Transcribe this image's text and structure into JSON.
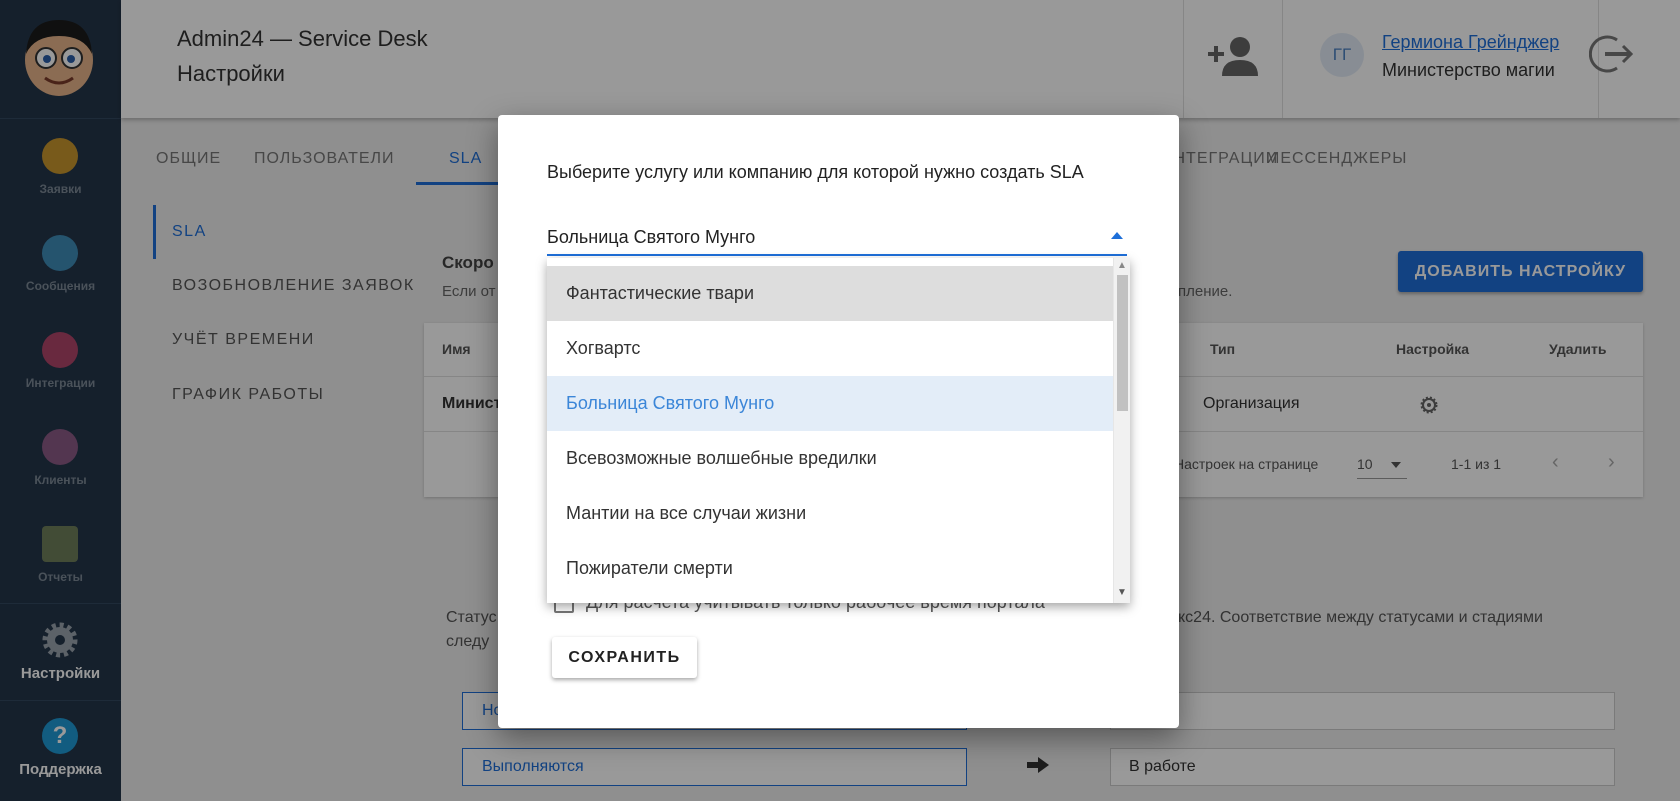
{
  "app": {
    "title": "Admin24 — Service Desk",
    "page": "Настройки"
  },
  "user": {
    "initials": "ГГ",
    "name": "Гермиона Грейнджер",
    "org": "Министерство магии"
  },
  "sidebar": {
    "items": [
      {
        "label": "Заявки",
        "icon": "megaphone-icon"
      },
      {
        "label": "Сообщения",
        "icon": "chat-icon"
      },
      {
        "label": "Интеграции",
        "icon": "puzzle-icon"
      },
      {
        "label": "Клиенты",
        "icon": "people-icon"
      },
      {
        "label": "Отчеты",
        "icon": "report-icon"
      },
      {
        "label": "Настройки",
        "icon": "gear-icon"
      },
      {
        "label": "Поддержка",
        "icon": "question-icon"
      }
    ]
  },
  "tabs": [
    "ОБЩИЕ",
    "ПОЛЬЗОВАТЕЛИ",
    "SLA",
    "ИНТЕГРАЦИИ",
    "МЕССЕНДЖЕРЫ"
  ],
  "left_menu": [
    "SLA",
    "ВОЗОБНОВЛЕНИЕ ЗАЯВОК",
    "УЧЁТ ВРЕМЕНИ",
    "ГРАФИК РАБОТЫ"
  ],
  "content": {
    "section_title": "Скоро",
    "section_desc": "Если от",
    "section_desc_end": "пление.",
    "add_button": "ДОБАВИТЬ НАСТРОЙКУ",
    "table": {
      "headers": {
        "name": "Имя",
        "type": "Тип",
        "setting": "Настройка",
        "delete": "Удалить"
      },
      "row": {
        "name": "Минист",
        "type": "Организация"
      },
      "pager": {
        "per_page_label": "Настроек на странице",
        "per_page": "10",
        "range": "1-1 из 1"
      }
    },
    "status_text": "Статус",
    "status_text2": "следу",
    "status_right": "кс24. Соответствие между статусами и стадиями",
    "stages": [
      {
        "stage": "Но",
        "status": ""
      },
      {
        "stage": "Выполняются",
        "status": "В работе"
      }
    ]
  },
  "modal": {
    "title": "Выберите услугу или компанию для которой нужно создать SLA",
    "select_value": "Больница Святого Мунго",
    "checkbox_label": "Для расчета учитывать только рабочее время портала",
    "save_button": "СОХРАНИТЬ",
    "options": [
      "Фантастические твари",
      "Хогвартс",
      "Больница Святого Мунго",
      "Всевозможные волшебные вредилки",
      "Мантии на все случаи жизни",
      "Пожиратели смерти"
    ],
    "hovered_index": 0,
    "selected_index": 2
  },
  "colors": {
    "accent": "#1e6fd9",
    "sidebar_bg": "#24364a",
    "selected_option_bg": "#e3edf8",
    "hover_option_bg": "#dddddd"
  }
}
